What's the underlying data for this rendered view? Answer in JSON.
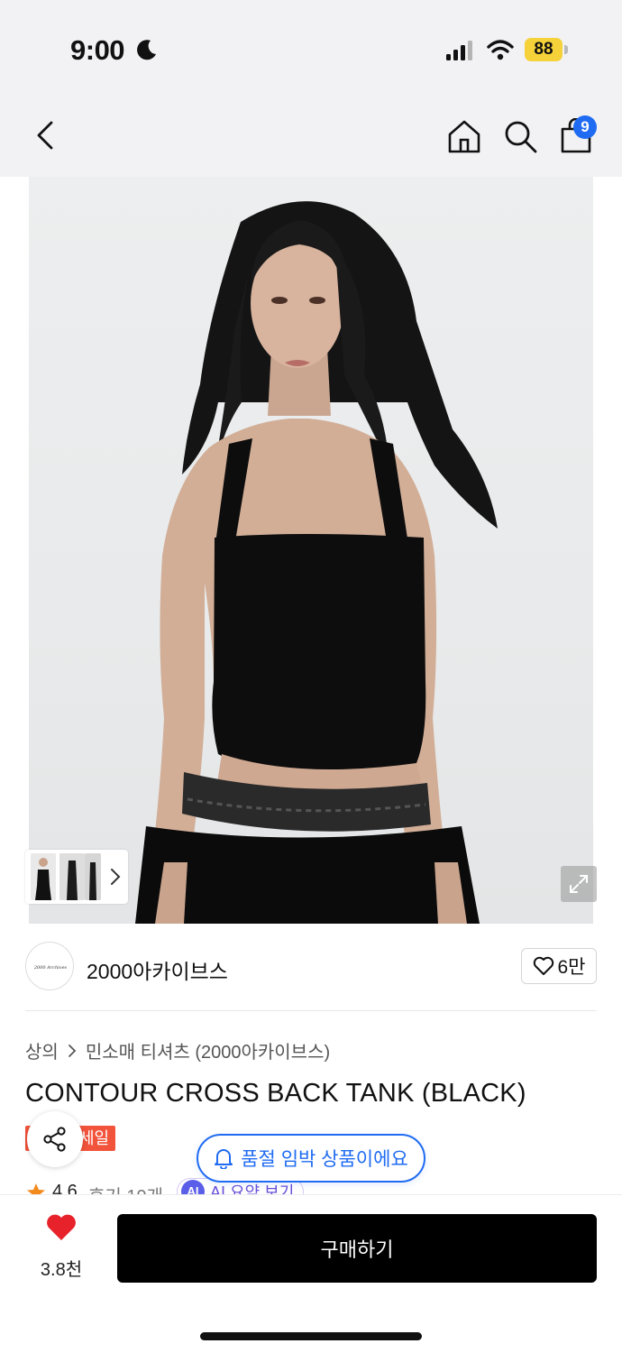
{
  "status_bar": {
    "time": "9:00",
    "battery": "88"
  },
  "header": {
    "cart_count": "9",
    "icons": [
      "back-icon",
      "home-icon",
      "search-icon",
      "shopping-bag-icon"
    ]
  },
  "brand": {
    "logo_text": "2000 Archives",
    "name": "2000아카이브스",
    "likes": "6만"
  },
  "breadcrumb": {
    "category": "상의",
    "subcategory": "민소매 티셔츠 (2000아카이브스)"
  },
  "product": {
    "title": "CONTOUR CROSS BACK TANK (BLACK)",
    "sale_badge": "세일",
    "rating": "4.6",
    "review_count": "후기 19개",
    "ai_summary_label": "AI 요약 보기",
    "ai_icon_label": "AI"
  },
  "toast": {
    "message": "품절 임박 상품이에요"
  },
  "bottom_bar": {
    "favorite_count": "3.8천",
    "buy_label": "구매하기"
  },
  "colors": {
    "accent_blue": "#1f6bf2",
    "sale_red": "#f2533b",
    "heart_red": "#e8222b",
    "star_orange": "#f28a1c",
    "battery_yellow": "#f6d23a"
  }
}
